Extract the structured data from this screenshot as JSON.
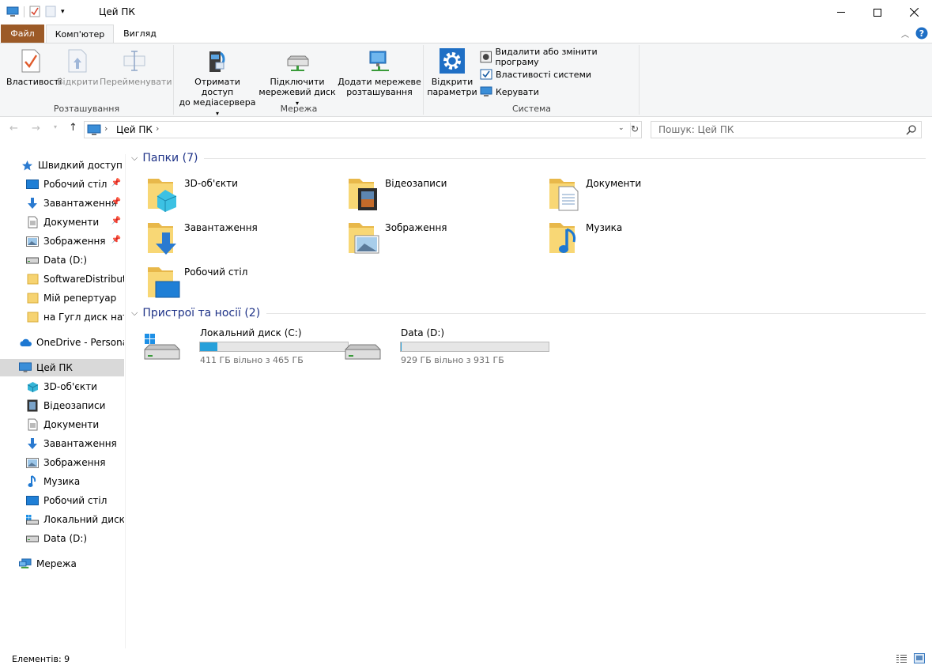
{
  "window": {
    "title": "Цей ПК"
  },
  "tabs": {
    "file": "Файл",
    "computer": "Комп'ютер",
    "view": "Вигляд"
  },
  "ribbon": {
    "location": {
      "label": "Розташування",
      "properties": "Властивості",
      "open": "Відкрити",
      "rename": "Перейменувати"
    },
    "network": {
      "label": "Мережа",
      "media_line1": "Отримати доступ",
      "media_line2": "до медіасервера",
      "map_line1": "Підключити",
      "map_line2": "мережевий диск",
      "add_line1": "Додати мережеве",
      "add_line2": "розташування"
    },
    "system": {
      "label": "Система",
      "settings_line1": "Відкрити",
      "settings_line2": "параметри",
      "uninstall": "Видалити або змінити програму",
      "sysprops": "Властивості системи",
      "manage": "Керувати"
    }
  },
  "address": {
    "crumb": "Цей ПК"
  },
  "search": {
    "placeholder": "Пошук: Цей ПК"
  },
  "sidebar": {
    "quick_access": "Швидкий доступ",
    "quick_items": [
      "Робочий стіл",
      "Завантаження",
      "Документи",
      "Зображення",
      "Data (D:)",
      "SoftwareDistribution",
      "Мій репертуар",
      "на Гугл диск натащ"
    ],
    "onedrive": "OneDrive - Personal",
    "this_pc": "Цей ПК",
    "pc_items": [
      "3D-об'єкти",
      "Відеозаписи",
      "Документи",
      "Завантаження",
      "Зображення",
      "Музика",
      "Робочий стіл",
      "Локальний диск (C:)",
      "Data (D:)"
    ],
    "network": "Мережа"
  },
  "folders": {
    "heading": "Папки (7)",
    "items": [
      "3D-об'єкти",
      "Відеозаписи",
      "Документи",
      "Завантаження",
      "Зображення",
      "Музика",
      "Робочий стіл"
    ]
  },
  "devices": {
    "heading": "Пристрої та носії (2)",
    "items": [
      {
        "name": "Локальний диск (C:)",
        "free": "411 ГБ вільно з 465 ГБ",
        "used_fraction": 0.116
      },
      {
        "name": "Data (D:)",
        "free": "929 ГБ вільно з 931 ГБ",
        "used_fraction": 0.002
      }
    ]
  },
  "status": {
    "count": "Елементів: 9"
  },
  "colors": {
    "accent": "#26a0da",
    "file_tab": "#9c5a27",
    "section": "#1e3287"
  }
}
